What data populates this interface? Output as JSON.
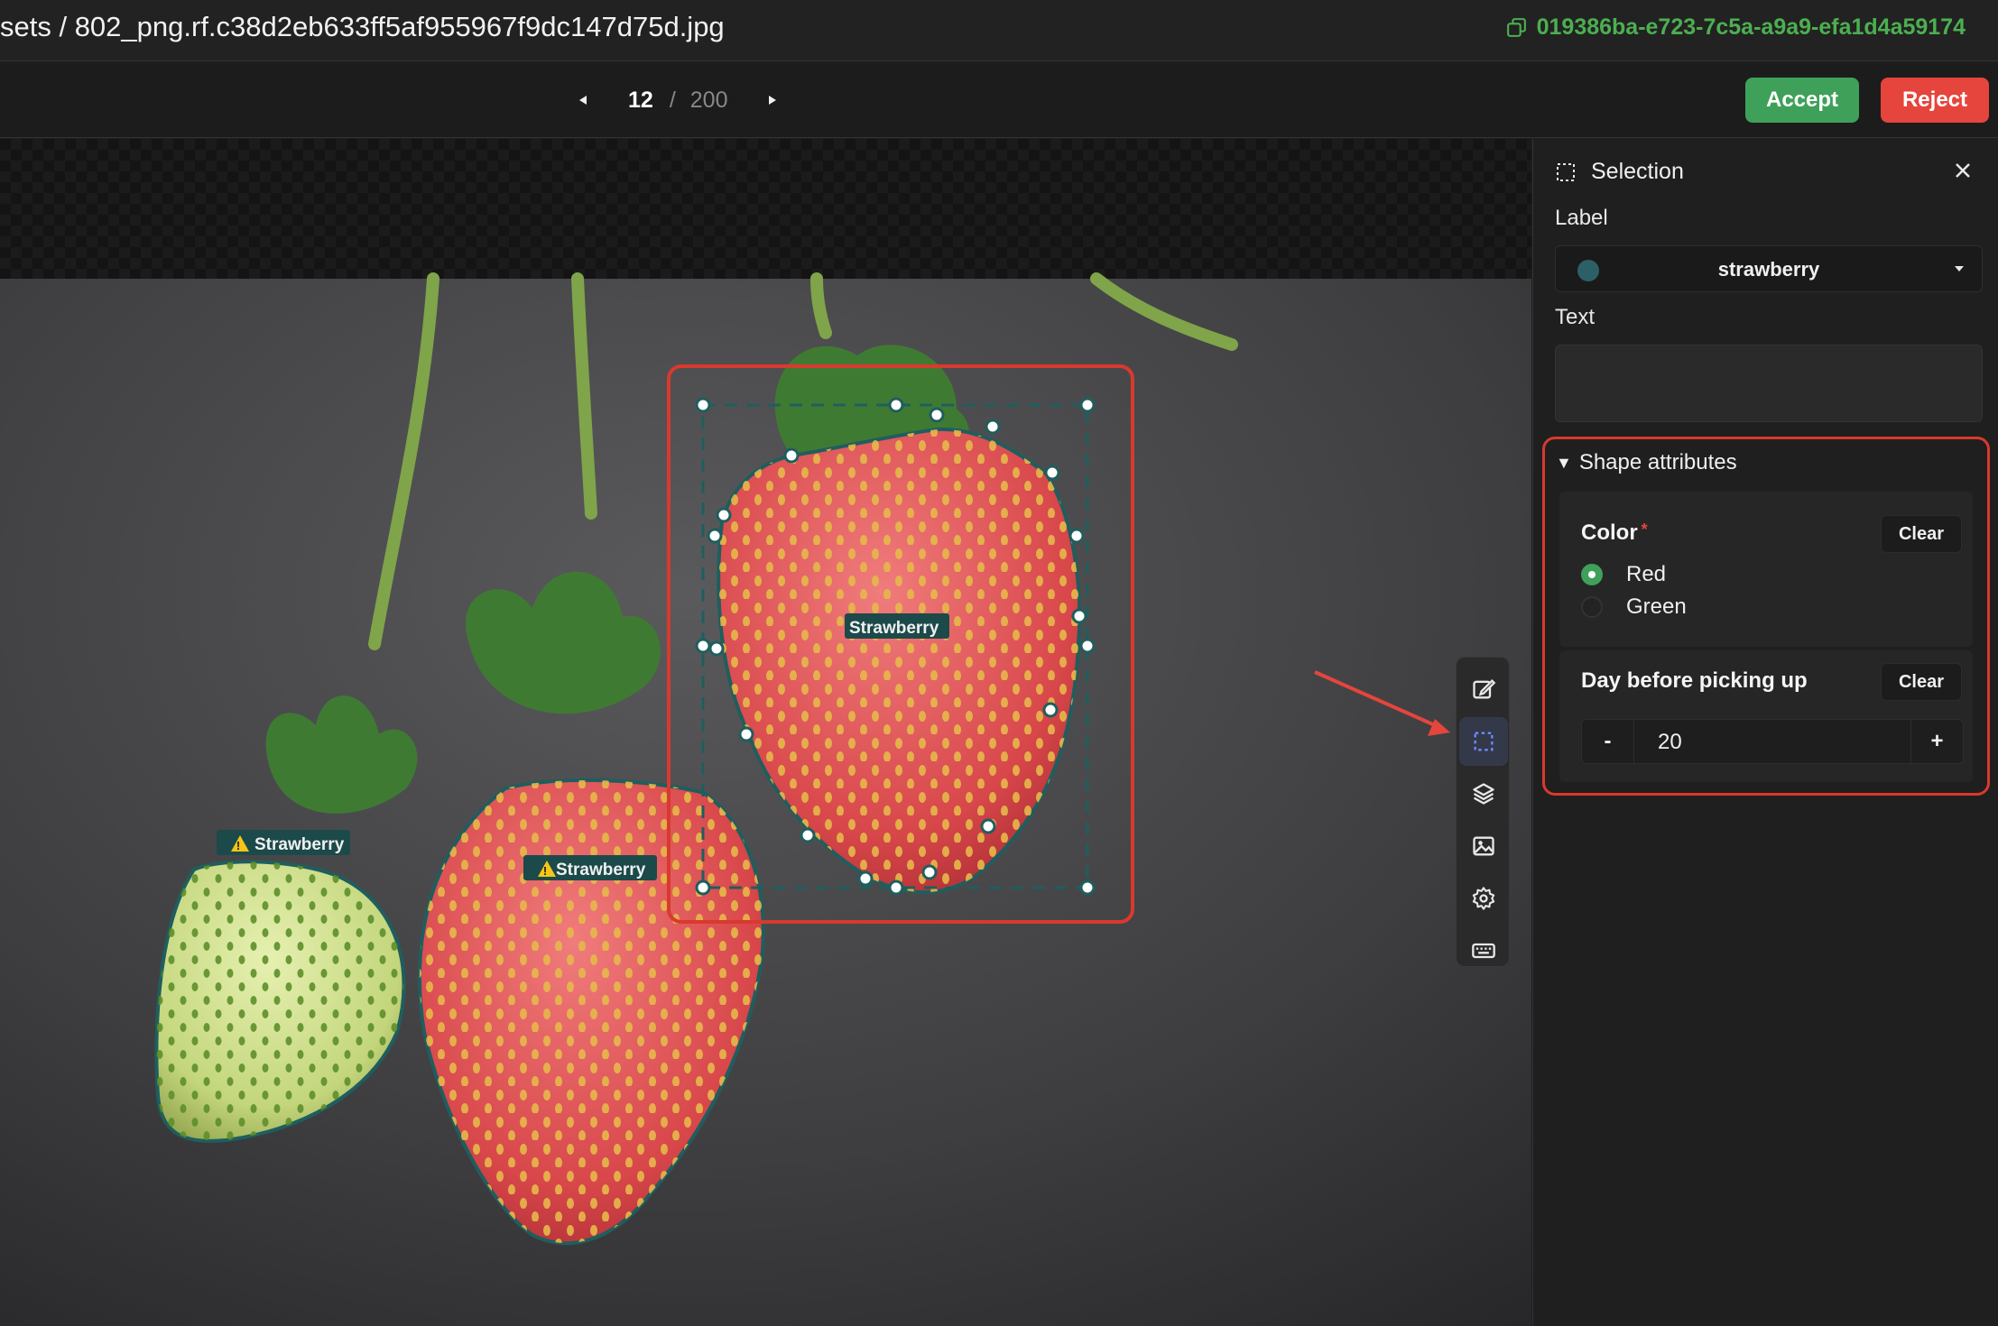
{
  "header": {
    "breadcrumb": "sets / 802_png.rf.c38d2eb633ff5af955967f9dc147d75d.jpg",
    "uuid": "019386ba-e723-7c5a-a9a9-efa1d4a59174"
  },
  "navbar": {
    "current_page": "12",
    "separator": "/",
    "total_pages": "200",
    "accept_label": "Accept",
    "reject_label": "Reject"
  },
  "canvas": {
    "annotations": [
      {
        "label": "Strawberry",
        "warning": true
      },
      {
        "label": "Strawberry",
        "warning": true
      },
      {
        "label": "Strawberry",
        "warning": false
      }
    ]
  },
  "toolbar": {
    "tools": [
      "edit-icon",
      "selection-icon",
      "layers-icon",
      "image-icon",
      "settings-icon",
      "keyboard-icon"
    ],
    "active": "selection-icon"
  },
  "panel": {
    "title": "Selection",
    "label_heading": "Label",
    "label_value": "strawberry",
    "label_color": "#2d5f66",
    "text_heading": "Text",
    "text_value": "",
    "shape_attributes_heading": "Shape attributes",
    "color_attr": {
      "title": "Color",
      "required_mark": "*",
      "clear_label": "Clear",
      "options": [
        {
          "label": "Red",
          "selected": true
        },
        {
          "label": "Green",
          "selected": false
        }
      ]
    },
    "day_attr": {
      "title": "Day before picking up",
      "clear_label": "Clear",
      "minus": "-",
      "value": "20",
      "plus": "+"
    }
  },
  "colors": {
    "accept": "#3fa05a",
    "reject": "#e5453c",
    "uuid_text": "#4caf50",
    "highlight": "#d9392e",
    "polygon": "#1f5e5e"
  }
}
